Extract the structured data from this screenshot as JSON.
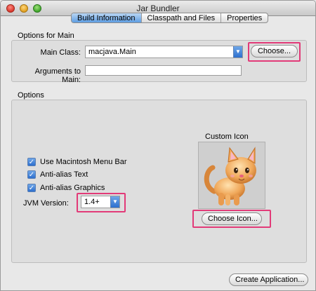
{
  "window": {
    "title": "Jar Bundler"
  },
  "tabs": [
    {
      "label": "Build Information",
      "active": true
    },
    {
      "label": "Classpath and Files",
      "active": false
    },
    {
      "label": "Properties",
      "active": false
    }
  ],
  "main_options": {
    "section_label": "Options for Main",
    "main_class_label": "Main Class:",
    "main_class_value": "macjava.Main",
    "choose_label": "Choose...",
    "arguments_label": "Arguments to Main:",
    "arguments_value": ""
  },
  "options": {
    "section_label": "Options",
    "checkboxes": [
      {
        "label": "Use Macintosh Menu Bar",
        "checked": true
      },
      {
        "label": "Anti-alias Text",
        "checked": true
      },
      {
        "label": "Anti-alias Graphics",
        "checked": true
      }
    ],
    "jvm_label": "JVM Version:",
    "jvm_value": "1.4+",
    "custom_icon_label": "Custom Icon",
    "choose_icon_label": "Choose Icon..."
  },
  "footer": {
    "create_label": "Create Application..."
  },
  "colors": {
    "highlight": "#e23a78",
    "accent": "#2d6fce"
  },
  "icons": {
    "custom_icon": "cat-icon",
    "checkmark": "checkmark-icon",
    "dropdown": "chevron-down-icon"
  }
}
